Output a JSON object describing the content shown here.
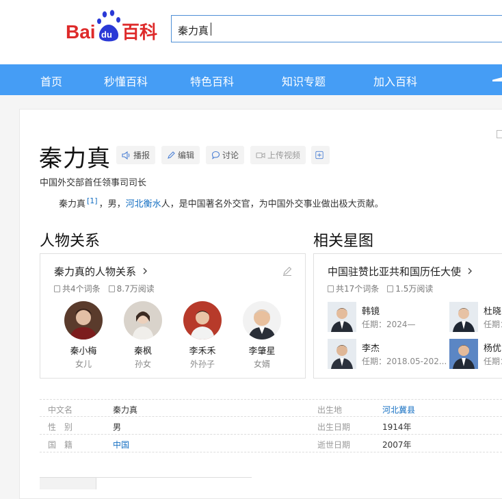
{
  "header": {
    "search_value": "秦力真"
  },
  "nav": {
    "items": [
      "首页",
      "秒懂百科",
      "特色百科",
      "知识专题",
      "加入百科"
    ]
  },
  "entry": {
    "title": "秦力真",
    "tools": [
      "播报",
      "编辑",
      "讨论",
      "上传视频"
    ],
    "subtitle": "中国外交部首任领事司司长",
    "summary_name": "秦力真",
    "summary_ref": "[1]",
    "summary_mid": "，男，",
    "summary_link": "河北衡水",
    "summary_rest": "人，是中国著名外交官，为中国外交事业做出极大贡献。"
  },
  "relations": {
    "section_title": "人物关系",
    "box_title": "秦力真的人物关系",
    "entries_count": "共4个词条",
    "reads": "8.7万阅读",
    "people": [
      {
        "name": "秦小梅",
        "role": "女儿"
      },
      {
        "name": "秦枫",
        "role": "孙女"
      },
      {
        "name": "李禾禾",
        "role": "外孙子"
      },
      {
        "name": "李肇星",
        "role": "女婿"
      }
    ]
  },
  "stars": {
    "section_title": "相关星图",
    "box_title": "中国驻赞比亚共和国历任大使",
    "entries_count": "共17个词条",
    "reads": "1.5万阅读",
    "ambassadors": [
      {
        "name": "韩镜",
        "term": "任期：2024—"
      },
      {
        "name": "杜晓",
        "term": "任期："
      },
      {
        "name": "李杰",
        "term": "任期：2018.05-202..."
      },
      {
        "name": "杨优",
        "term": "任期："
      }
    ]
  },
  "basic_info": [
    {
      "k1": "中文名",
      "v1": "秦力真",
      "k2": "出生地",
      "v2": "河北冀县"
    },
    {
      "k1": "性　别",
      "v1": "男",
      "k2": "出生日期",
      "v2": "1914年"
    },
    {
      "k1": "国　籍",
      "v1": "中国",
      "k2": "逝世日期",
      "v2": "2007年"
    }
  ],
  "colors": {
    "nav": "#459df5",
    "link": "#136ec2",
    "logo_red": "#de2a2a",
    "logo_blue": "#2a39d6"
  }
}
